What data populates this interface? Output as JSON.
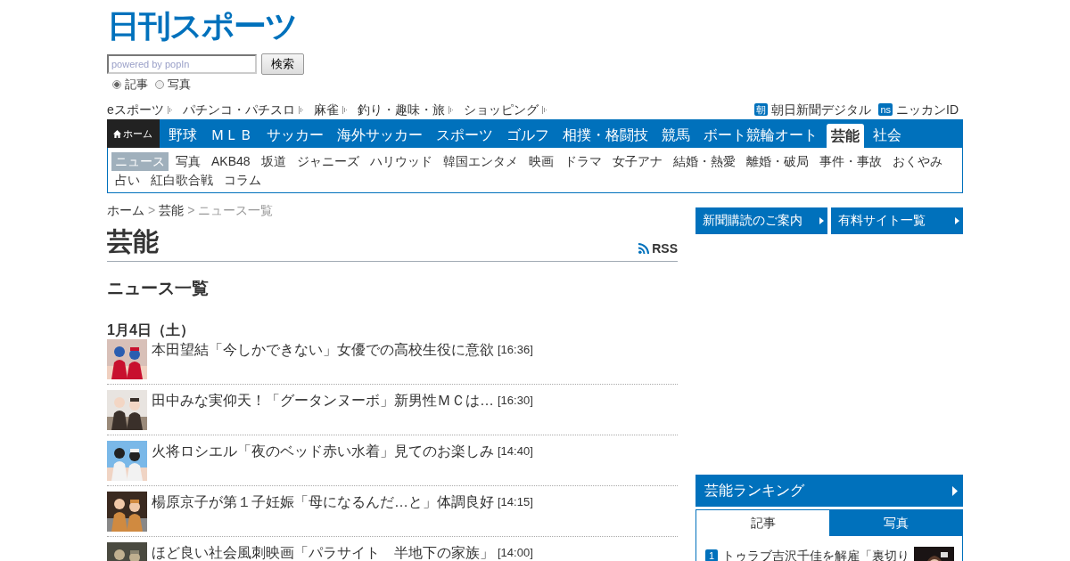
{
  "logo": "日刊スポーツ",
  "search": {
    "placeholder": "powered by popIn",
    "button": "検索"
  },
  "search_scope": [
    {
      "label": "記事",
      "selected": true
    },
    {
      "label": "写真",
      "selected": false
    }
  ],
  "top_links": [
    "eスポーツ",
    "パチンコ・パチスロ",
    "麻雀",
    "釣り・趣味・旅",
    "ショッピング"
  ],
  "partner_links": [
    {
      "badge": "朝",
      "label": "朝日新聞デジタル"
    },
    {
      "badge": "ns",
      "label": "ニッカンID"
    }
  ],
  "nav": {
    "home": "ホーム",
    "items": [
      {
        "label": "野球",
        "selected": false
      },
      {
        "label": "ＭＬＢ",
        "selected": false
      },
      {
        "label": "サッカー",
        "selected": false
      },
      {
        "label": "海外サッカー",
        "selected": false
      },
      {
        "label": "スポーツ",
        "selected": false
      },
      {
        "label": "ゴルフ",
        "selected": false
      },
      {
        "label": "相撲・格闘技",
        "selected": false
      },
      {
        "label": "競馬",
        "selected": false
      },
      {
        "label": "ボート競輪オート",
        "selected": false
      },
      {
        "label": "芸能",
        "selected": true
      },
      {
        "label": "社会",
        "selected": false
      }
    ]
  },
  "subnav": [
    {
      "label": "ニュース",
      "selected": true
    },
    {
      "label": "写真",
      "selected": false
    },
    {
      "label": "AKB48",
      "selected": false
    },
    {
      "label": "坂道",
      "selected": false
    },
    {
      "label": "ジャニーズ",
      "selected": false
    },
    {
      "label": "ハリウッド",
      "selected": false
    },
    {
      "label": "韓国エンタメ",
      "selected": false
    },
    {
      "label": "映画",
      "selected": false
    },
    {
      "label": "ドラマ",
      "selected": false
    },
    {
      "label": "女子アナ",
      "selected": false
    },
    {
      "label": "結婚・熱愛",
      "selected": false
    },
    {
      "label": "離婚・破局",
      "selected": false
    },
    {
      "label": "事件・事故",
      "selected": false
    },
    {
      "label": "おくやみ",
      "selected": false
    },
    {
      "label": "占い",
      "selected": false
    },
    {
      "label": "紅白歌合戦",
      "selected": false
    },
    {
      "label": "コラム",
      "selected": false
    }
  ],
  "breadcrumb": {
    "separator": ">",
    "items": [
      "ホーム",
      "芸能",
      "ニュース一覧"
    ]
  },
  "page_title": "芸能",
  "rss": "RSS",
  "section_title": "ニュース一覧",
  "date": "1月4日（土）",
  "news": [
    {
      "title": "本田望結「今しかできない」女優での高校生役に意欲",
      "time": "[16:36]"
    },
    {
      "title": "田中みな実仰天！「グータンヌーボ」新男性ＭＣは…",
      "time": "[16:30]"
    },
    {
      "title": "火将ロシエル「夜のベッド赤い水着」見てのお楽しみ",
      "time": "[14:40]"
    },
    {
      "title": "楊原京子が第１子妊娠「母になるんだ…と」体調良好",
      "time": "[14:15]"
    },
    {
      "title": "ほど良い社会風刺映画「パラサイト　半地下の家族」",
      "time": "[14:00]"
    }
  ],
  "sidebar_buttons": [
    "新聞購読のご案内",
    "有料サイト一覧"
  ],
  "ranking": {
    "title": "芸能ランキング",
    "tabs": [
      {
        "label": "記事",
        "selected": true
      },
      {
        "label": "写真",
        "selected": false
      }
    ],
    "items": [
      {
        "rank": "1",
        "title": "トゥラブ吉沢千佳を解雇「裏切り"
      }
    ]
  }
}
